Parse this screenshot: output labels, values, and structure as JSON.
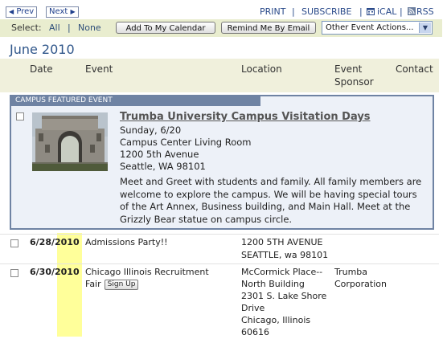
{
  "nav": {
    "prev_label": "Prev",
    "next_label": "Next"
  },
  "toplinks": {
    "print": "PRINT",
    "subscribe": "SUBSCRIBE",
    "ical": "iCAL",
    "rss": "RSS",
    "separator": "|"
  },
  "selection": {
    "select_label": "Select:",
    "all_label": "All",
    "none_label": "None",
    "separator": "|",
    "add_calendar_button": "Add To My Calendar",
    "remind_email_button": "Remind Me By Email",
    "other_actions_selected": "Other Event Actions..."
  },
  "month_heading": "June 2010",
  "columns": {
    "date": "Date",
    "event": "Event",
    "location": "Location",
    "sponsor_line1": "Event",
    "sponsor_line2": "Sponsor",
    "contact": "Contact"
  },
  "featured": {
    "tab_label": "CAMPUS FEATURED EVENT",
    "title": "Trumba University Campus Visitation Days",
    "date": "Sunday, 6/20",
    "place": "Campus Center Living Room",
    "street": "1200 5th Avenue",
    "city": "Seattle, WA 98101",
    "description": "Meet and Greet with students and family. All family members are welcome to explore the campus. We will be having special tours of the Art Annex, Business building, and Main Hall. Meet at the Grizzly Bear statue on campus circle."
  },
  "events": [
    {
      "date_prefix": "6/28/",
      "date_year": "2010",
      "title": "Admissions Party!!",
      "location_lines": [
        "1200 5TH AVENUE",
        "SEATTLE, wa 98101"
      ],
      "sponsor_lines": []
    },
    {
      "date_prefix": "6/30/",
      "date_year": "2010",
      "title_line1": "Chicago Illinois Recruitment",
      "title_line2": "Fair",
      "signup_label": "Sign Up",
      "location_lines": [
        "McCormick Place--",
        "North Building",
        "2301 S. Lake Shore",
        "Drive",
        "Chicago, Illinois",
        "60616"
      ],
      "sponsor_lines": [
        "Trumba",
        "Corporation"
      ]
    }
  ],
  "colors": {
    "link": "#2a4a8a",
    "heading": "#2f568a",
    "select_bar": "#e9edcf",
    "year_highlight": "#ffff9a",
    "featured_border": "#6f83a3"
  }
}
